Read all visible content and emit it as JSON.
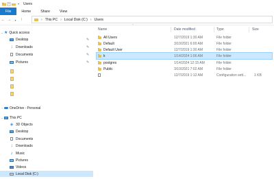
{
  "window": {
    "title": "Users"
  },
  "ribbon": {
    "tabs": [
      "File",
      "Home",
      "Share",
      "View"
    ]
  },
  "address": {
    "crumbs": [
      "This PC",
      "Local Disk (C:)",
      "Users"
    ]
  },
  "sidebar": {
    "quick_access": "Quick access",
    "quick_items": [
      "Desktop",
      "Downloads",
      "Documents",
      "Pictures"
    ],
    "onedrive": "OneDrive - Personal",
    "this_pc": "This PC",
    "pc_items": [
      "3D Objects",
      "Desktop",
      "Documents",
      "Downloads",
      "Music",
      "Pictures",
      "Videos",
      "Local Disk (C:)"
    ]
  },
  "columns": {
    "name": "Name",
    "date": "Date modified",
    "type": "Type",
    "size": "Size"
  },
  "files": [
    {
      "name": "All Users",
      "date": "12/7/2019 1:30 AM",
      "type": "File folder",
      "size": "",
      "icon": "shortcut-folder-icon"
    },
    {
      "name": "Default",
      "date": "3/10/2021 6:00 AM",
      "type": "File folder",
      "size": "",
      "icon": "folder-icon"
    },
    {
      "name": "Default User",
      "date": "12/7/2019 1:30 AM",
      "type": "File folder",
      "size": "",
      "icon": "shortcut-folder-icon"
    },
    {
      "name": "k",
      "date": "1/14/2024 1:06 AM",
      "type": "File folder",
      "size": "",
      "icon": "folder-icon"
    },
    {
      "name": "postgres",
      "date": "1/14/2024 12:15 AM",
      "type": "File folder",
      "size": "",
      "icon": "folder-icon"
    },
    {
      "name": "Public",
      "date": "3/10/2021 7:02 AM",
      "type": "File folder",
      "size": "",
      "icon": "folder-icon"
    },
    {
      "name": "",
      "date": "12/7/2019 1:12 AM",
      "type": "Configuration sett...",
      "size": "1 KB",
      "icon": "file-icon"
    }
  ],
  "colors": {
    "accent": "#1979ca",
    "selection": "#cce8ff",
    "folder": "#e8c14e"
  }
}
